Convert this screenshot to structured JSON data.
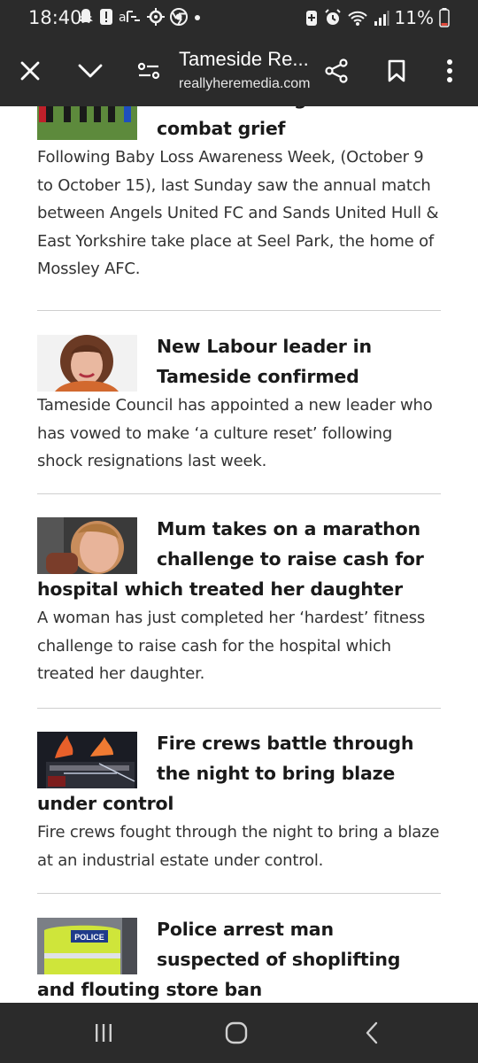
{
  "status_bar": {
    "time": "18:40",
    "battery": "11%",
    "left_icons": [
      "snapchat-icon",
      "alert-icon",
      "air-quality-icon",
      "settings-sun-icon",
      "chrome-icon",
      "dot-icon"
    ],
    "right_icons": [
      "battery-saver-icon",
      "alarm-icon",
      "wifi-icon",
      "signal-icon",
      "battery-icon"
    ]
  },
  "toolbar": {
    "title": "Tameside Re...",
    "url": "reallyheremedia.com",
    "icons": [
      "close-icon",
      "chevron-down-icon",
      "page-settings-icon",
      "share-icon",
      "bookmark-icon",
      "more-vert-icon"
    ]
  },
  "articles": [
    {
      "headline": "Dads come together to combat grief",
      "summary": "Following Baby Loss Awareness Week, (October 9 to October 15), last Sunday saw the annual match between Angels United FC and Sands United Hull & East Yorkshire take place at Seel Park, the home of Mossley AFC."
    },
    {
      "headline": "New Labour leader in Tameside confirmed",
      "summary": "Tameside Council has appointed a new leader who has vowed to make ‘a culture reset’ following shock resignations last week."
    },
    {
      "headline": "Mum takes on a marathon challenge to raise cash for hospital which treated her daughter",
      "summary": "A woman has just completed her ‘hardest’ fitness challenge to raise cash for the hospital which treated her daughter."
    },
    {
      "headline": "Fire crews battle through the night to bring blaze under control",
      "summary": "Fire crews fought through the night to bring a blaze at an industrial estate under control."
    },
    {
      "headline": "Police arrest man suspected of shoplifting and flouting store ban",
      "summary": ""
    }
  ],
  "police_badge_text": "POLICE",
  "nav_bar": {
    "icons": [
      "recent-apps-icon",
      "home-icon",
      "back-icon"
    ]
  }
}
